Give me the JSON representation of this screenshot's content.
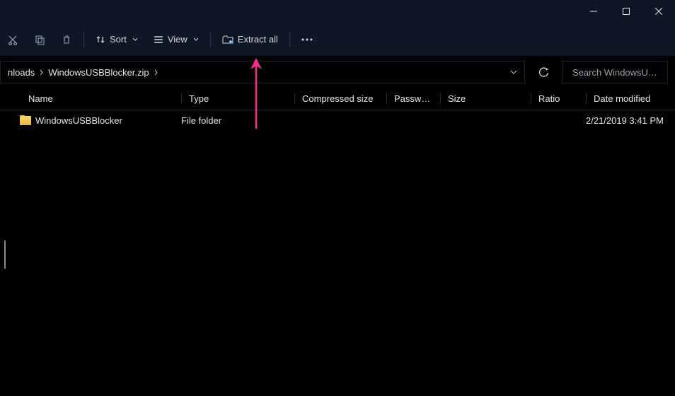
{
  "titlebar": {
    "min": "Minimize",
    "max": "Maximize",
    "close": "Close"
  },
  "toolbar": {
    "sort_label": "Sort",
    "view_label": "View",
    "extractall_label": "Extract all"
  },
  "breadcrumb": {
    "seg0": "nloads",
    "seg1": "WindowsUSBBlocker.zip"
  },
  "search": {
    "placeholder": "Search WindowsU…"
  },
  "columns": {
    "name": "Name",
    "type": "Type",
    "csize": "Compressed size",
    "pwd": "Password …",
    "size": "Size",
    "ratio": "Ratio",
    "date": "Date modified"
  },
  "rows": [
    {
      "name": "WindowsUSBBlocker",
      "type": "File folder",
      "csize": "",
      "pwd": "",
      "size": "",
      "ratio": "",
      "date": "2/21/2019 3:41 PM"
    }
  ],
  "annotation_color": "#ff2a8a"
}
